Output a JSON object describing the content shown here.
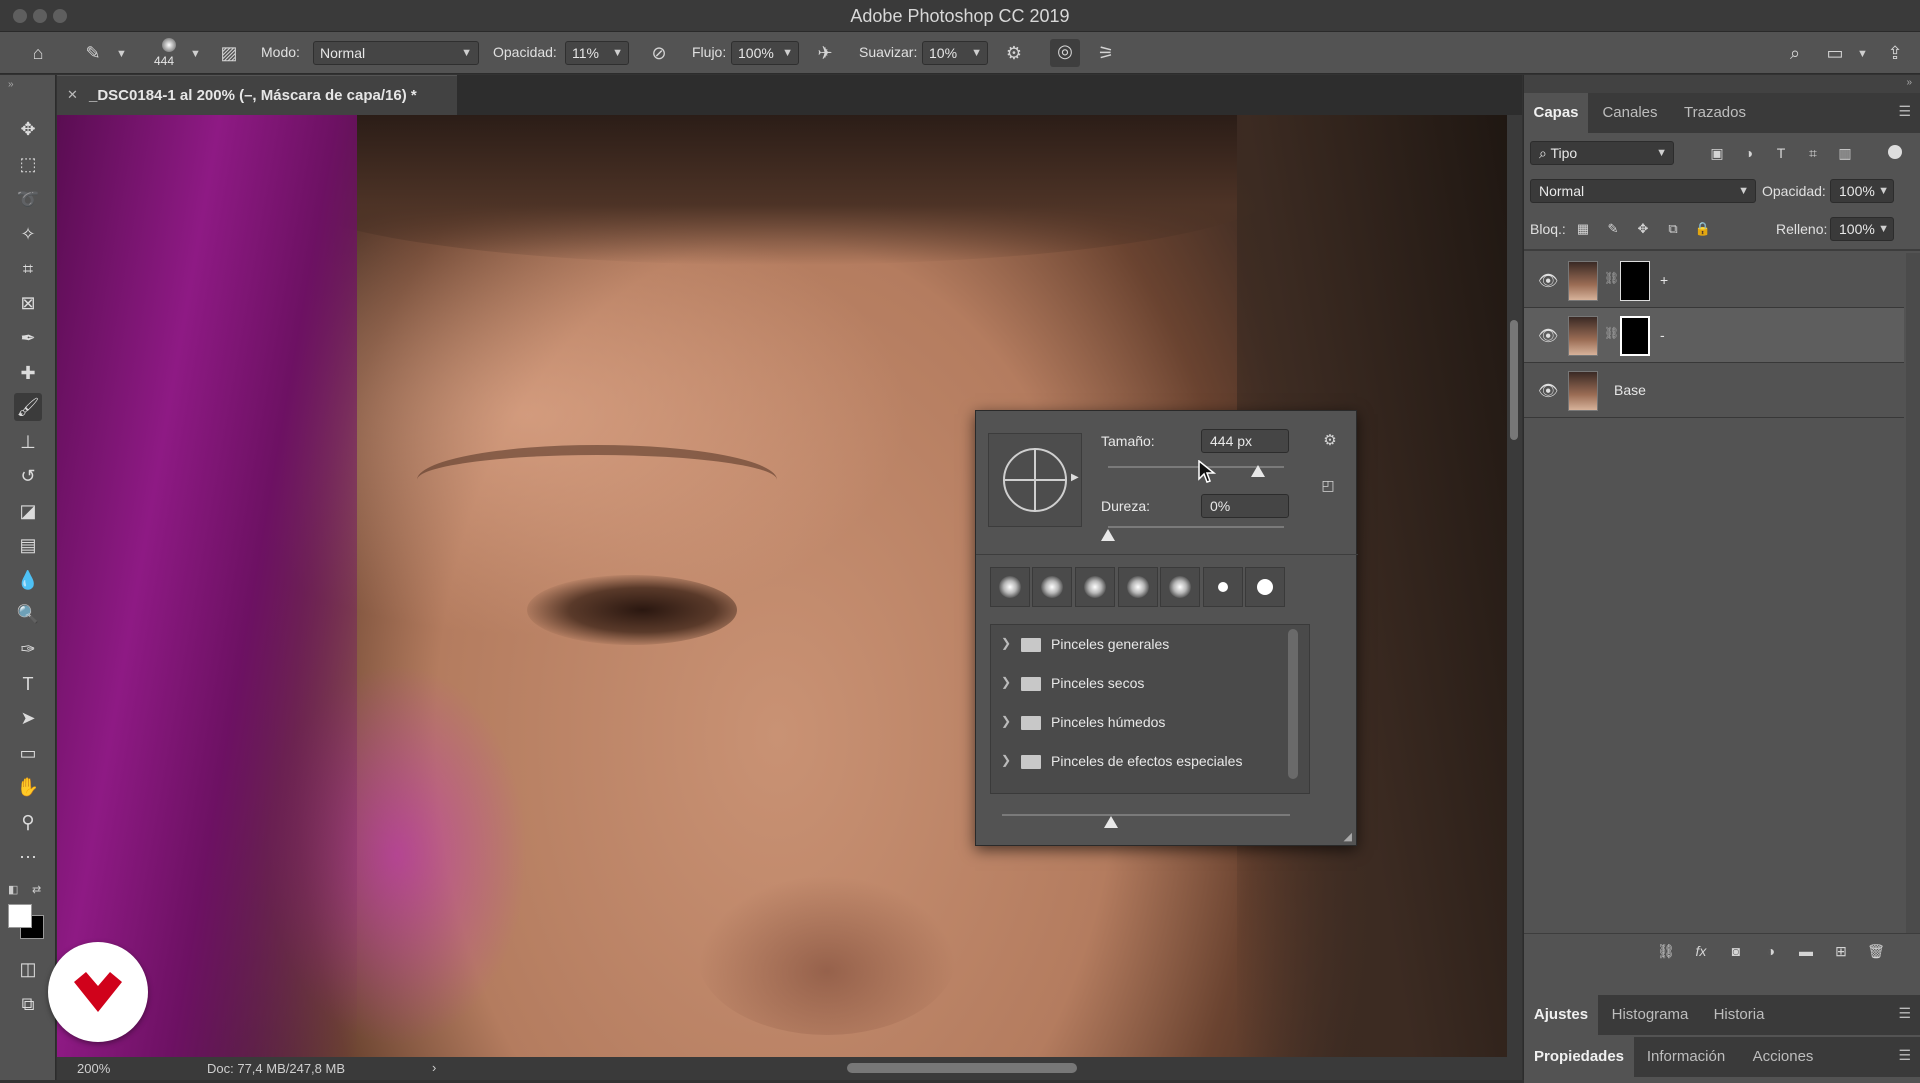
{
  "window": {
    "title": "Adobe Photoshop CC 2019"
  },
  "options_bar": {
    "brush_size": "444",
    "mode_label": "Modo:",
    "mode_value": "Normal",
    "opacity_label": "Opacidad:",
    "opacity_value": "11%",
    "flow_label": "Flujo:",
    "flow_value": "100%",
    "smoothing_label": "Suavizar:",
    "smoothing_value": "10%"
  },
  "document": {
    "tab_title": "_DSC0184-1 al 200% (–, Máscara de capa/16) *",
    "zoom": "200%",
    "doc_info": "Doc: 77,4 MB/247,8 MB"
  },
  "brush_popup": {
    "size_label": "Tamaño:",
    "size_value": "444 px",
    "size_fraction": 0.85,
    "hardness_label": "Dureza:",
    "hardness_value": "0%",
    "hardness_fraction": 0.0,
    "folders": [
      "Pinceles generales",
      "Pinceles secos",
      "Pinceles húmedos",
      "Pinceles de efectos especiales"
    ]
  },
  "layers_panel": {
    "tabs": [
      "Capas",
      "Canales",
      "Trazados"
    ],
    "filter_kind": "Tipo",
    "blend_mode": "Normal",
    "opacity_label": "Opacidad:",
    "opacity_value": "100%",
    "lock_label": "Bloq.:",
    "fill_label": "Relleno:",
    "fill_value": "100%",
    "layers": [
      {
        "name": "+",
        "has_mask": true,
        "selected": false
      },
      {
        "name": "-",
        "has_mask": true,
        "selected": true
      },
      {
        "name": "Base",
        "has_mask": false,
        "selected": false
      }
    ]
  },
  "bottom_panels": {
    "row1_tabs": [
      "Ajustes",
      "Histograma",
      "Historia"
    ],
    "row2_tabs": [
      "Propiedades",
      "Información",
      "Acciones"
    ]
  },
  "colors": {
    "ui_dark": "#323232",
    "ui_panel": "#535353",
    "selected_layer": "#5e5e5e",
    "logo_red": "#d0021b"
  }
}
